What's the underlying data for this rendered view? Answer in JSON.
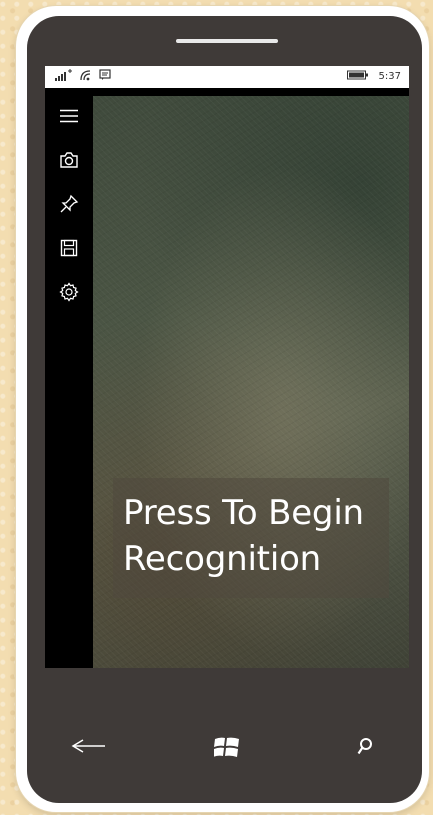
{
  "status_bar": {
    "time": "5:37",
    "icons": [
      "signal-icon",
      "wifi-icon",
      "message-icon",
      "battery-icon"
    ]
  },
  "sidebar": {
    "items": [
      {
        "icon": "menu-icon"
      },
      {
        "icon": "camera-icon"
      },
      {
        "icon": "pin-icon"
      },
      {
        "icon": "save-icon"
      },
      {
        "icon": "settings-icon"
      }
    ]
  },
  "main": {
    "recognize_button_line1": "Press To Begin",
    "recognize_button_line2": "Recognition"
  },
  "hardware_nav": {
    "buttons": [
      "back-icon",
      "windows-icon",
      "search-icon"
    ]
  }
}
